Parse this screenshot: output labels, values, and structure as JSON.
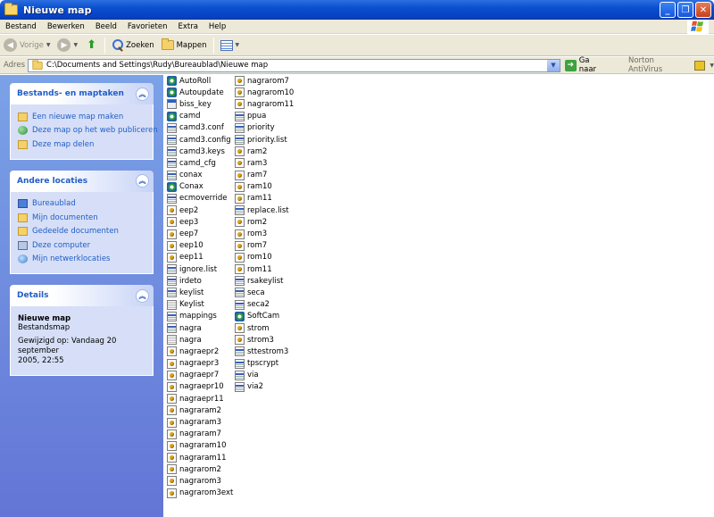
{
  "window": {
    "title": "Nieuwe map"
  },
  "menu": [
    "Bestand",
    "Bewerken",
    "Beeld",
    "Favorieten",
    "Extra",
    "Help"
  ],
  "toolbar": {
    "back_label": "Vorige",
    "search_label": "Zoeken",
    "folders_label": "Mappen"
  },
  "address": {
    "label": "Adres",
    "path": "C:\\Documents and Settings\\Rudy\\Bureaublad\\Nieuwe map",
    "go_label": "Ga naar",
    "norton_label": "Norton AntiVirus"
  },
  "taskpane": {
    "tasks": {
      "title": "Bestands- en maptaken",
      "items": [
        "Een nieuwe map maken",
        "Deze map op het web publiceren",
        "Deze map delen"
      ]
    },
    "places": {
      "title": "Andere locaties",
      "items": [
        "Bureaublad",
        "Mijn documenten",
        "Gedeelde documenten",
        "Deze computer",
        "Mijn netwerklocaties"
      ]
    },
    "details": {
      "title": "Details",
      "name": "Nieuwe map",
      "type": "Bestandsmap",
      "modified_line1": "Gewijzigd op: Vandaag 20 september",
      "modified_line2": "2005, 22:55"
    }
  },
  "files": {
    "col1": [
      {
        "name": "AutoRoll",
        "icon": "exe-icon"
      },
      {
        "name": "Autoupdate",
        "icon": "exe-icon"
      },
      {
        "name": "biss_key",
        "icon": "file-icon"
      },
      {
        "name": "camd",
        "icon": "exe-icon"
      },
      {
        "name": "camd3.conf",
        "icon": "config-icon"
      },
      {
        "name": "camd3.config",
        "icon": "config-icon"
      },
      {
        "name": "camd3.keys",
        "icon": "config-icon"
      },
      {
        "name": "camd_cfg",
        "icon": "config-icon"
      },
      {
        "name": "conax",
        "icon": "config-icon"
      },
      {
        "name": "Conax",
        "icon": "exe-icon"
      },
      {
        "name": "ecmoverride",
        "icon": "config-icon"
      },
      {
        "name": "eep2",
        "icon": "generic-icon"
      },
      {
        "name": "eep3",
        "icon": "generic-icon"
      },
      {
        "name": "eep7",
        "icon": "generic-icon"
      },
      {
        "name": "eep10",
        "icon": "generic-icon"
      },
      {
        "name": "eep11",
        "icon": "generic-icon"
      },
      {
        "name": "ignore.list",
        "icon": "config-icon"
      },
      {
        "name": "irdeto",
        "icon": "config-icon"
      },
      {
        "name": "keylist",
        "icon": "config-icon"
      },
      {
        "name": "Keylist",
        "icon": "text-icon"
      },
      {
        "name": "mappings",
        "icon": "config-icon"
      },
      {
        "name": "nagra",
        "icon": "config-icon"
      },
      {
        "name": "nagra",
        "icon": "text-icon"
      },
      {
        "name": "nagraepr2",
        "icon": "generic-icon"
      },
      {
        "name": "nagraepr3",
        "icon": "generic-icon"
      },
      {
        "name": "nagraepr7",
        "icon": "generic-icon"
      },
      {
        "name": "nagraepr10",
        "icon": "generic-icon"
      },
      {
        "name": "nagraepr11",
        "icon": "generic-icon"
      },
      {
        "name": "nagraram2",
        "icon": "generic-icon"
      },
      {
        "name": "nagraram3",
        "icon": "generic-icon"
      },
      {
        "name": "nagraram7",
        "icon": "generic-icon"
      },
      {
        "name": "nagraram10",
        "icon": "generic-icon"
      },
      {
        "name": "nagraram11",
        "icon": "generic-icon"
      },
      {
        "name": "nagrarom2",
        "icon": "generic-icon"
      },
      {
        "name": "nagrarom3",
        "icon": "generic-icon"
      },
      {
        "name": "nagrarom3ext",
        "icon": "generic-icon"
      }
    ],
    "col2": [
      {
        "name": "nagrarom7",
        "icon": "generic-icon"
      },
      {
        "name": "nagrarom10",
        "icon": "generic-icon"
      },
      {
        "name": "nagrarom11",
        "icon": "generic-icon"
      },
      {
        "name": "ppua",
        "icon": "config-icon"
      },
      {
        "name": "priority",
        "icon": "config-icon"
      },
      {
        "name": "priority.list",
        "icon": "config-icon"
      },
      {
        "name": "ram2",
        "icon": "generic-icon"
      },
      {
        "name": "ram3",
        "icon": "generic-icon"
      },
      {
        "name": "ram7",
        "icon": "generic-icon"
      },
      {
        "name": "ram10",
        "icon": "generic-icon"
      },
      {
        "name": "ram11",
        "icon": "generic-icon"
      },
      {
        "name": "replace.list",
        "icon": "config-icon"
      },
      {
        "name": "rom2",
        "icon": "generic-icon"
      },
      {
        "name": "rom3",
        "icon": "generic-icon"
      },
      {
        "name": "rom7",
        "icon": "generic-icon"
      },
      {
        "name": "rom10",
        "icon": "generic-icon"
      },
      {
        "name": "rom11",
        "icon": "generic-icon"
      },
      {
        "name": "rsakeylist",
        "icon": "config-icon"
      },
      {
        "name": "seca",
        "icon": "config-icon"
      },
      {
        "name": "seca2",
        "icon": "config-icon"
      },
      {
        "name": "SoftCam",
        "icon": "exe-icon"
      },
      {
        "name": "strom",
        "icon": "generic-icon"
      },
      {
        "name": "strom3",
        "icon": "generic-icon"
      },
      {
        "name": "sttestrom3",
        "icon": "config-icon"
      },
      {
        "name": "tpscrypt",
        "icon": "config-icon"
      },
      {
        "name": "via",
        "icon": "config-icon"
      },
      {
        "name": "via2",
        "icon": "config-icon"
      }
    ]
  },
  "colors": {
    "titlebar": "#0a4fd0",
    "taskpane": "#6f8fe0",
    "link": "#215dc6",
    "chrome": "#ece9d8"
  }
}
